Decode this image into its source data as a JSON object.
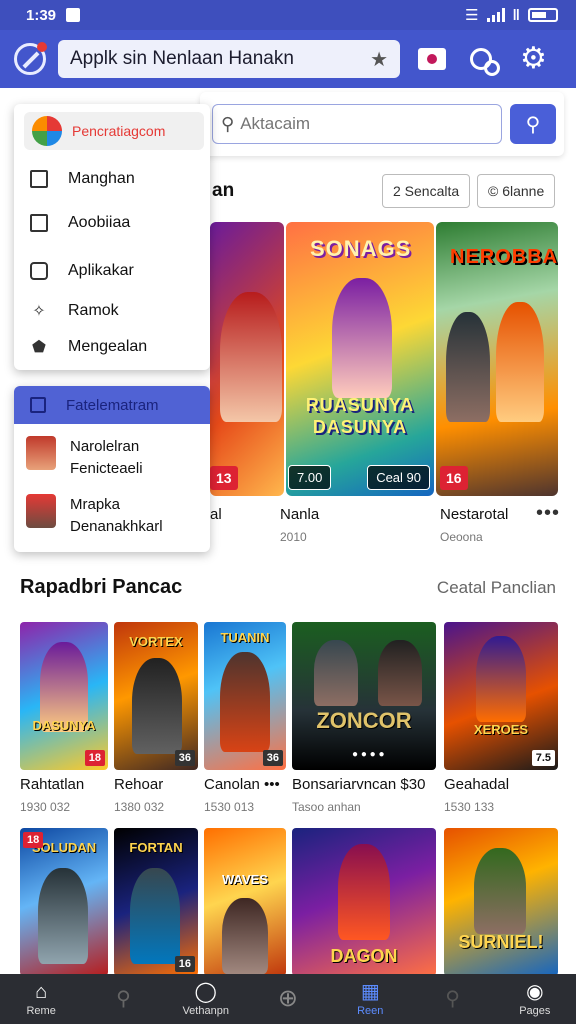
{
  "status_bar": {
    "time": "1:39",
    "status_icons": [
      "wifi-icon",
      "signal-icon",
      "battery-icon"
    ]
  },
  "app_bar": {
    "title": "Applk sin Nenlaan Hanakn",
    "icons": [
      "app-logo-icon",
      "star-icon",
      "flag-icon",
      "user-link-icon",
      "gear-icon"
    ]
  },
  "search": {
    "placeholder": "Aktacaim"
  },
  "filters": {
    "chip1": "2 Sencalta",
    "chip2": "© 6lanne"
  },
  "featured": {
    "section_label_partial": "an",
    "banners": [
      {
        "title": "",
        "badge": "13"
      },
      {
        "title": "SONAGS",
        "subtitle": "RUASUNYA DASUNYA",
        "badge_left": "7.00",
        "badge_right": "Ceal 90"
      },
      {
        "title": "NEROBBA",
        "badge": "16"
      }
    ],
    "items": [
      {
        "name": "al",
        "sub": ""
      },
      {
        "name": "Nanla",
        "sub": "2010"
      },
      {
        "name": "Nestarotal",
        "sub": "Oeoona"
      }
    ],
    "more": "•••"
  },
  "menu": {
    "header": "Pencratiagcom",
    "items": [
      {
        "label": "Manghan",
        "icon": "edit-icon"
      },
      {
        "label": "Aoobiiaa",
        "icon": "checkbox-icon"
      },
      {
        "label": "Aplikakar",
        "icon": "app-icon"
      },
      {
        "label": "Ramok",
        "icon": "puzzle-icon"
      },
      {
        "label": "Mengealan",
        "icon": "shield-icon"
      }
    ]
  },
  "menu2": {
    "header": "Fatelematram",
    "items": [
      {
        "line1": "Narolelran",
        "line2": "Fenicteaeli"
      },
      {
        "line1": "Mrapka",
        "line2": "Denanakhkarl"
      }
    ]
  },
  "recommended": {
    "title": "Rapadbri  Pancac",
    "link": "Ceatal Panclian",
    "row1": [
      {
        "art": "DASUNYA",
        "badge": "18",
        "name": "Rahtatlan",
        "sub": "1930 032"
      },
      {
        "art": "VORTEX",
        "badge": "36",
        "name": "Rehoar",
        "sub": "1380 032"
      },
      {
        "art": "TUANIN",
        "badge": "36",
        "name": "Canolan •••",
        "sub": "1530 013"
      },
      {
        "art": "ZONCOR",
        "badge": "",
        "name": "Bonsariarvncan  $30",
        "sub": "Tasoo anhan"
      },
      {
        "art": "XEROES",
        "badge": "7.5",
        "name": "Geahadal",
        "sub": "1530 133"
      }
    ],
    "row2": [
      {
        "art": "SOLUDAN",
        "badge": "18"
      },
      {
        "art": "FORTAN",
        "badge": "16"
      },
      {
        "art": "WAVES",
        "badge": ""
      },
      {
        "art": "DAGON",
        "badge": ""
      },
      {
        "art": "SURNIEL!",
        "badge": ""
      }
    ]
  },
  "bottom_nav": [
    {
      "label": "Reme",
      "icon": "home-icon"
    },
    {
      "label": "",
      "icon": "search-icon"
    },
    {
      "label": "Vethanpn",
      "icon": "person-icon"
    },
    {
      "label": "",
      "icon": "add-icon"
    },
    {
      "label": "Reen",
      "icon": "apps-icon"
    },
    {
      "label": "",
      "icon": "search-icon"
    },
    {
      "label": "Pages",
      "icon": "profile-icon"
    }
  ],
  "colors": {
    "primary": "#4356cc",
    "accent": "#4a5fd8",
    "badge": "#dd2233",
    "nav_bg": "#2b2d33"
  }
}
